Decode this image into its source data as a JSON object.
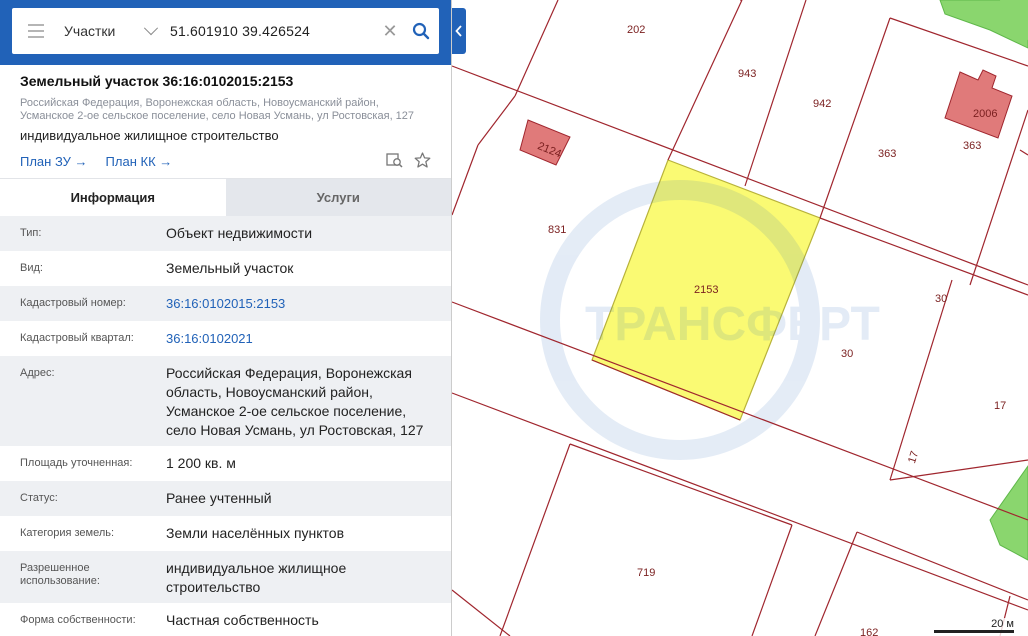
{
  "search": {
    "layer": "Участки",
    "coords": "51.601910 39.426524"
  },
  "parcel": {
    "title": "Земельный участок 36:16:0102015:2153",
    "address_line1": "Российская Федерация, Воронежская область, Новоусманский район,",
    "address_line2": "Усманское 2-ое сельское поселение, село Новая Усмань, ул Ростовская, 127",
    "use": "индивидуальное жилищное строительство",
    "link_plan_zu": "План ЗУ",
    "link_plan_kk": "План КК"
  },
  "tabs": {
    "info": "Информация",
    "services": "Услуги"
  },
  "rows": [
    {
      "label": "Тип:",
      "value": "Объект недвижимости"
    },
    {
      "label": "Вид:",
      "value": "Земельный участок"
    },
    {
      "label": "Кадастровый номер:",
      "value": "36:16:0102015:2153"
    },
    {
      "label": "Кадастровый квартал:",
      "value": "36:16:0102021"
    },
    {
      "label": "Адрес:",
      "value": "Российская Федерация, Воронежская область, Новоусманский район, Усманское 2-ое сельское поселение, село Новая Усмань, ул Ростовская, 127"
    },
    {
      "label": "Площадь уточненная:",
      "value": "1 200 кв. м"
    },
    {
      "label": "Статус:",
      "value": "Ранее учтенный"
    },
    {
      "label": "Категория земель:",
      "value": "Земли населённых пунктов"
    },
    {
      "label": "Разрешенное использование:",
      "value": "индивидуальное жилищное строительство"
    },
    {
      "label": "Форма собственности:",
      "value": "Частная собственность"
    }
  ],
  "map": {
    "parcels": [
      "202",
      "943",
      "942",
      "363",
      "363",
      "2006",
      "2124",
      "831",
      "2153",
      "30",
      "30",
      "17",
      "17",
      "719",
      "162"
    ],
    "scale_label": "20 м",
    "colors": {
      "boundary": "#a0262e",
      "selected": "#fafa73",
      "building": "#e07a7a",
      "road": "#8ad66e"
    }
  }
}
